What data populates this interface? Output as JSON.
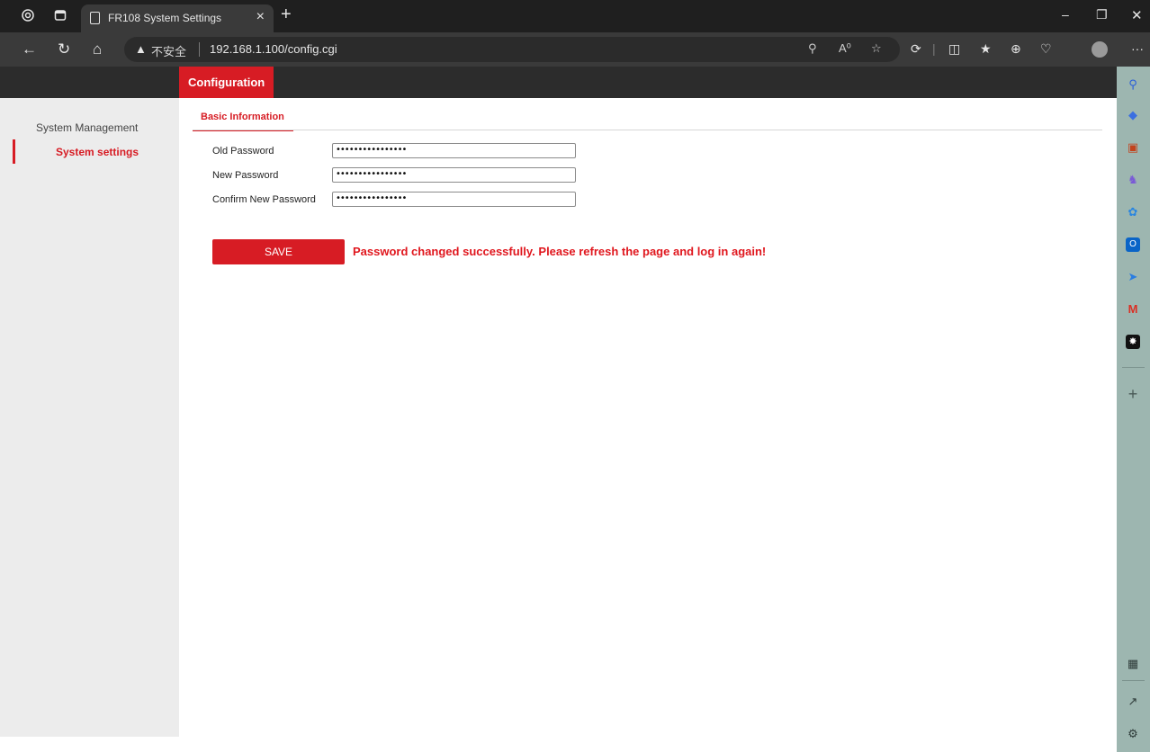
{
  "browser": {
    "tab_title": "FR108 System Settings",
    "tab_close": "×",
    "new_tab": "+",
    "insecure_label": "不安全",
    "url": "192.168.1.100/config.cgi",
    "more_menu": "···"
  },
  "topnav": {
    "active_label": "Configuration"
  },
  "sidebar": {
    "section_title": "System Management",
    "items": [
      {
        "label": "System settings"
      }
    ]
  },
  "content": {
    "tab_label": "Basic Information",
    "fields": [
      {
        "label": "Old Password",
        "value": "••••••••••••••••"
      },
      {
        "label": "New Password",
        "value": "••••••••••••••••"
      },
      {
        "label": "Confirm New Password",
        "value": "••••••••••••••••"
      }
    ],
    "save_label": "SAVE",
    "success_message": "Password changed successfully. Please refresh the page and log in again!"
  },
  "colors": {
    "accent": "#d71c24",
    "nav_bg": "#2c2c2c",
    "sidebar_bg": "#ececec",
    "edge_sidebar_bg": "#9db6b0"
  }
}
